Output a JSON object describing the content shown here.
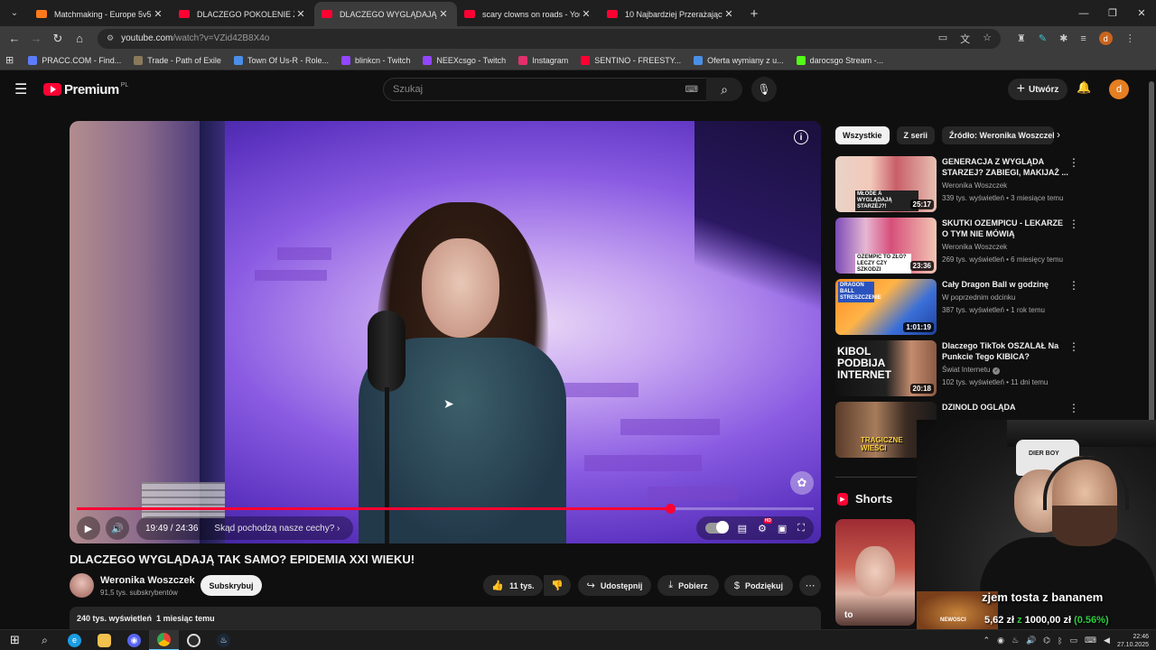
{
  "browser": {
    "tabs": [
      {
        "title": "Matchmaking - Europe 5v5 Qu",
        "favicon_color": "#ff7a1a",
        "active": false
      },
      {
        "title": "DLACZEGO POKOLENIE Z NIE M",
        "favicon_color": "#ff0033",
        "active": false
      },
      {
        "title": "DLACZEGO WYGLĄDAJĄ TAK S",
        "favicon_color": "#ff0033",
        "active": true
      },
      {
        "title": "scary clowns on roads - YouTub",
        "favicon_color": "#ff0033",
        "active": false
      },
      {
        "title": "10 Najbardziej Przerażających P",
        "favicon_color": "#ff0033",
        "active": false
      }
    ],
    "url_host": "youtube.com",
    "url_path": "/watch?v=VZid42B8X4o",
    "profile_initial": "d",
    "bookmarks": [
      {
        "label": "PRACC.COM - Find...",
        "color": "#5b7cfa"
      },
      {
        "label": "Trade - Path of Exile",
        "color": "#8a7a5a"
      },
      {
        "label": "Town Of Us-R - Role...",
        "color": "#4a8fe7"
      },
      {
        "label": "blinkcn - Twitch",
        "color": "#9146ff"
      },
      {
        "label": "NEEXcsgo - Twitch",
        "color": "#9146ff"
      },
      {
        "label": "Instagram",
        "color": "#e1306c"
      },
      {
        "label": "SENTINO - FREESTY...",
        "color": "#ff0033"
      },
      {
        "label": "Oferta wymiany z u...",
        "color": "#4a8fe7"
      },
      {
        "label": "darocsgo Stream -...",
        "color": "#53fc18"
      }
    ]
  },
  "header": {
    "brand": "Premium",
    "region": "PL",
    "search_placeholder": "Szukaj",
    "create_label": "Utwórz",
    "avatar_initial": "d"
  },
  "player": {
    "time_current": "19:49",
    "time_total": "24:36",
    "time_sep": " / ",
    "chapter": "Skąd pochodzą nasze cechy?",
    "progress": 0.805,
    "hd_badge": "HD"
  },
  "video": {
    "title": "DLACZEGO WYGLĄDAJĄ TAK SAMO? EPIDEMIA XXI WIEKU!",
    "channel": "Weronika Woszczek",
    "subscribers": "91,5 tys. subskrybentów",
    "subscribe_label": "Subskrybuj",
    "likes": "11 tys.",
    "share_label": "Udostępnij",
    "download_label": "Pobierz",
    "thanks_label": "Podziękuj",
    "views": "240 tys. wyświetleń",
    "age": "1 miesiąc temu"
  },
  "sidebar": {
    "chips": [
      "Wszystkie",
      "Z serii",
      "Źródło: Weronika Woszczek"
    ],
    "recommendations": [
      {
        "title": "GENERACJA Z WYGLĄDA STARZEJ? ZABIEGI, MAKIJAŻ ...",
        "channel": "Weronika Woszczek",
        "meta": "339 tys. wyświetleń • 3 miesiące temu",
        "duration": "25:17",
        "thumb_overlay": "MŁODE A WYGLĄDAJĄ STARZEJ?!",
        "verified": false
      },
      {
        "title": "SKUTKI OZEMPICU - LEKARZE O TYM NIE MÓWIĄ",
        "channel": "Weronika Woszczek",
        "meta": "269 tys. wyświetleń • 6 miesięcy temu",
        "duration": "23:36",
        "thumb_overlay": "OZEMPIC TO ZŁO? LECZY CZY SZKODZI",
        "verified": false
      },
      {
        "title": "Cały Dragon Ball w godzinę",
        "channel": "W poprzednim odcinku",
        "meta": "387 tys. wyświetleń • 1 rok temu",
        "duration": "1:01:19",
        "thumb_overlay": "DRAGON BALL STRESZCZENIE",
        "verified": false
      },
      {
        "title": "Dlaczego TikTok OSZALAŁ Na Punkcie Tego KIBICA?",
        "channel": "Świat Internetu",
        "meta": "102 tys. wyświetleń • 11 dni temu",
        "duration": "20:18",
        "thumb_overlay": "KIBOL PODBIJA INTERNET",
        "verified": true
      },
      {
        "title": "DZINOLD OGLĄDA",
        "channel": "",
        "meta": "",
        "duration": "",
        "thumb_overlay": "TRAGICZNE WIEŚCI",
        "verified": false
      }
    ],
    "shorts_label": "Shorts",
    "short_caption": "to"
  },
  "webcam": {
    "hat_text": "DIER BOY",
    "caption": "zjem tosta z bananem",
    "amount_current": "5,62 zł",
    "amount_sep": "z",
    "amount_goal": "1000,00 zł",
    "percent": "(0.56%)",
    "brand": "NEWOSCI"
  },
  "taskbar": {
    "time": "22:46",
    "date": "27.10.2025"
  },
  "colors": {
    "accent": "#ff0033",
    "background": "#0f0f0f",
    "chip": "#272727",
    "money_green": "#2ecc40"
  }
}
